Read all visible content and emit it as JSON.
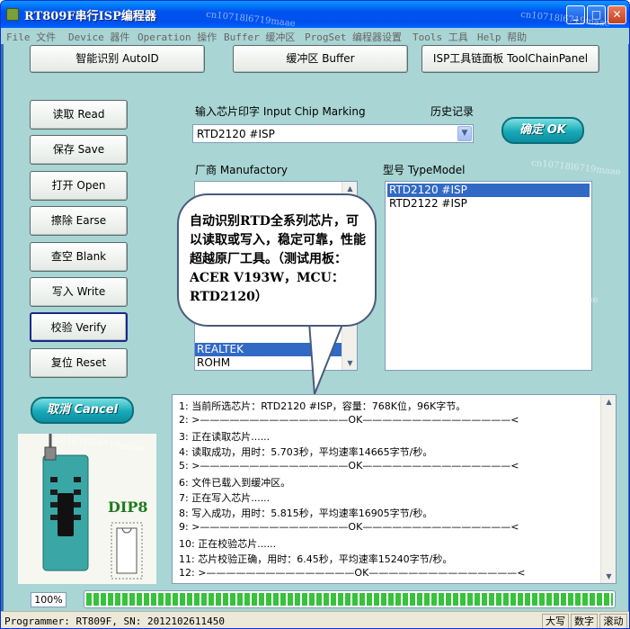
{
  "window": {
    "title": "RT809F串行ISP编程器",
    "min": "_",
    "max": "□",
    "close": "✕"
  },
  "menu": [
    "File 文件",
    "Device 器件",
    "Operation 操作",
    "Buffer 缓冲区",
    "ProgSet 编程器设置",
    "Tools 工具",
    "Help 帮助"
  ],
  "toolbar": {
    "autoid": "智能识别 AutoID",
    "buffer": "缓冲区 Buffer",
    "toolchain": "ISP工具链面板  ToolChainPanel"
  },
  "side_buttons": {
    "read": "读取 Read",
    "save": "保存 Save",
    "open": "打开 Open",
    "erase": "擦除 Earse",
    "blank": "查空 Blank",
    "write": "写入 Write",
    "verify": "校验 Verify",
    "reset": "复位 Reset"
  },
  "chip_marking": {
    "label": "输入芯片印字 Input Chip Marking",
    "value": "RTD2120 #ISP",
    "history_label": "历史记录"
  },
  "ok_button": "确定 OK",
  "cancel_button": "取消 Cancel",
  "manufactory": {
    "label": "厂商 Manufactory",
    "items": [
      "REALTEK",
      "ROHM"
    ],
    "selected": "REALTEK"
  },
  "type_model": {
    "label": "型号 TypeModel",
    "items": [
      "RTD2120 #ISP",
      "RTD2122 #ISP"
    ],
    "selected": "RTD2120 #ISP"
  },
  "callout": "自动识别RTD全系列芯片，可以读取或写入，稳定可靠，性能超越原厂工具。（测试用板：ACER V193W，MCU：RTD2120）",
  "log": [
    "1: 当前所选芯片：RTD2120 #ISP，容量：768K位，96K字节。",
    "2: >———————————————OK———————————————<",
    "3: 正在读取芯片......",
    "4: 读取成功，用时：5.703秒，平均速率14665字节/秒。",
    "5: >———————————————OK———————————————<",
    "6: 文件已载入到缓冲区。",
    "7: 正在写入芯片......",
    "8: 写入成功，用时：5.815秒，平均速率16905字节/秒。",
    "9: >———————————————OK———————————————<",
    "10: 正在校验芯片......",
    "11: 芯片校验正确，用时：6.45秒，平均速率15240字节/秒。",
    "12: >———————————————OK———————————————<"
  ],
  "dip_label": "DIP8",
  "progress": {
    "text": "100%",
    "value": 1.0
  },
  "status": {
    "main": "Programmer: RT809F, SN: 2012102611450",
    "caps": "大写",
    "num": "数字",
    "scroll": "滚动"
  },
  "watermark": "cn10718l6719maae",
  "colors": {
    "client_bg": "#a9d5d4",
    "title_bar": "#0053ee",
    "selection": "#316ac5",
    "progress": "#37c23b"
  }
}
